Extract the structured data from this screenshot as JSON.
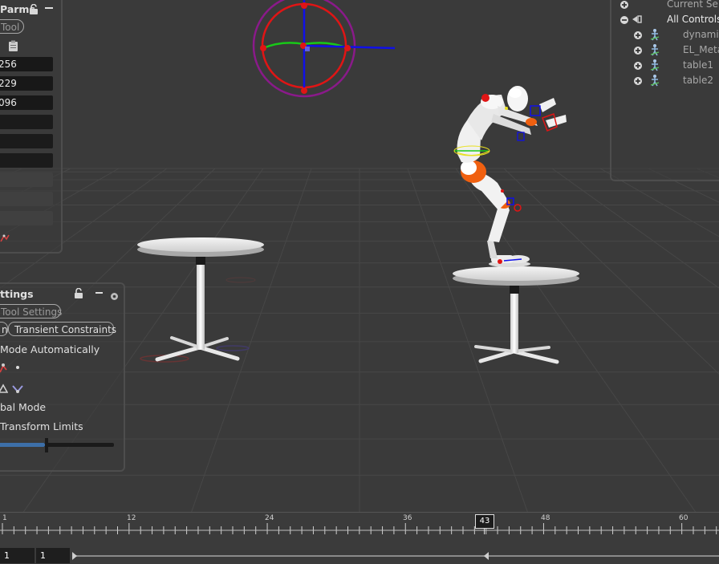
{
  "parms_panel": {
    "title": "Parms",
    "tool_pill": "Tool",
    "fields": [
      "256",
      "229",
      "096",
      "",
      "",
      "",
      "",
      "",
      ""
    ]
  },
  "tool_settings_panel": {
    "title": "ttings",
    "tool_settings_pill": "Tool Settings",
    "tab_left": "n",
    "tab_transient": "Transient Constraints",
    "mode_auto": "Mode Automatically",
    "pal_mode": "bal Mode",
    "transform_limits": "Transform Limits",
    "slider_value": 0.4
  },
  "tree_panel": {
    "rows": [
      {
        "label": "Current Sele",
        "expander": "plus",
        "icon": ""
      },
      {
        "label": "All Controls",
        "expander": "minus",
        "icon": "control-group"
      },
      {
        "label": "dynamic",
        "expander": "plus",
        "icon": "figure"
      },
      {
        "label": "EL_Meta",
        "expander": "plus",
        "icon": "figure"
      },
      {
        "label": "table1",
        "expander": "plus",
        "icon": "figure"
      },
      {
        "label": "table2",
        "expander": "plus",
        "icon": "figure"
      }
    ]
  },
  "timeline": {
    "tick_labels": [
      "1",
      "12",
      "24",
      "36",
      "48",
      "60"
    ],
    "current_frame": "43",
    "range_start": "1",
    "range_start2": "1"
  },
  "colors": {
    "viewport_bg": "#3a3a3a",
    "grid": "#4a4a4a",
    "handle_red": "#e01515",
    "handle_green": "#18c818",
    "handle_blue": "#1010e8",
    "handle_purple": "#8a1a8a",
    "accent_orange": "#f06010"
  },
  "icons": {
    "lock": "lock-icon",
    "minus": "minus-icon",
    "clipboard": "clipboard-icon",
    "gear": "gear-icon"
  }
}
